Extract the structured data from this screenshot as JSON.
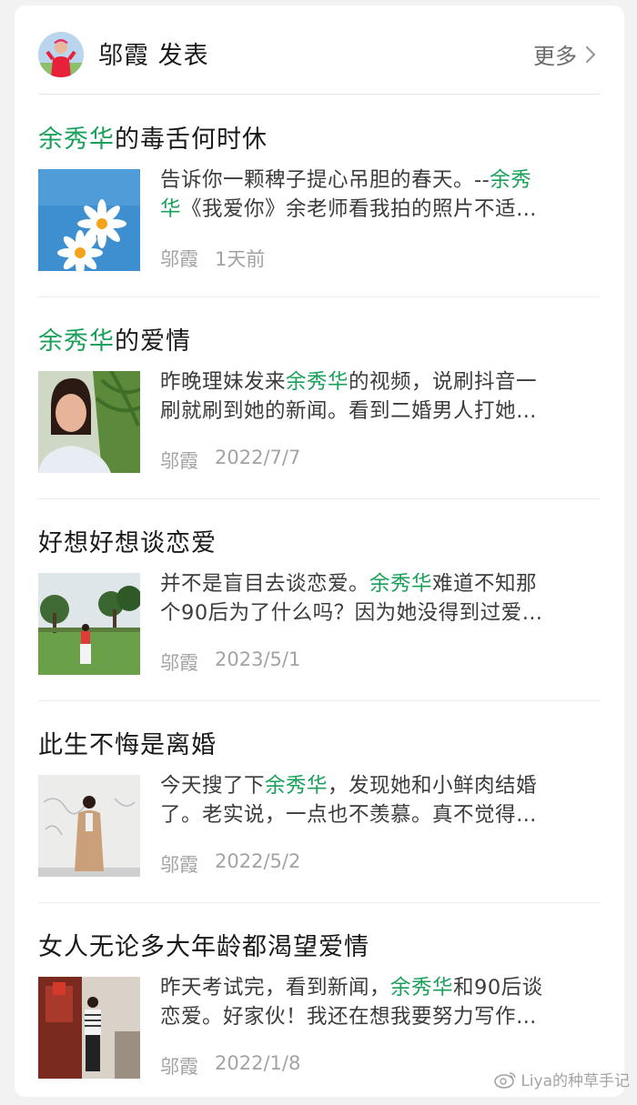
{
  "header": {
    "author": "邬霞",
    "action": "发表",
    "more_label": "更多"
  },
  "articles": [
    {
      "title_highlight": "余秀华",
      "title_rest": "的毒舌何时休",
      "excerpt_line1_a": "告诉你一颗稗子提心吊胆的春天。--",
      "excerpt_line1_hl": "余秀",
      "excerpt_line2_hl": "华",
      "excerpt_line2_b": "《我爱你》余老师看我拍的照片不适…",
      "author": "邬霞",
      "time": "1天前"
    },
    {
      "title_highlight": "余秀华",
      "title_rest": "的爱情",
      "excerpt_line1_a": "昨晚理妹发来",
      "excerpt_line1_hl": "余秀华",
      "excerpt_line1_b": "的视频，说刷抖音一",
      "excerpt_line2": "刷就刷到她的新闻。看到二婚男人打她…",
      "author": "邬霞",
      "time": "2022/7/7"
    },
    {
      "title": "好想好想谈恋爱",
      "excerpt_line1_a": "并不是盲目去谈恋爱。",
      "excerpt_line1_hl": "余秀华",
      "excerpt_line1_b": "难道不知那",
      "excerpt_line2": "个90后为了什么吗？因为她没得到过爱…",
      "author": "邬霞",
      "time": "2023/5/1"
    },
    {
      "title": "此生不悔是离婚",
      "excerpt_line1_a": "今天搜了下",
      "excerpt_line1_hl": "余秀华",
      "excerpt_line1_b": "，发现她和小鲜肉结婚",
      "excerpt_line2": "了。老实说，一点也不羡慕。真不觉得…",
      "author": "邬霞",
      "time": "2022/5/2"
    },
    {
      "title": "女人无论多大年龄都渴望爱情",
      "excerpt_line1_a": "昨天考试完，看到新闻，",
      "excerpt_line1_hl": "余秀华",
      "excerpt_line1_b": "和90后谈",
      "excerpt_line2": "恋爱。好家伙！我还在想我要努力写作…",
      "author": "邬霞",
      "time": "2022/1/8"
    }
  ],
  "watermark": "Liya的种草手记",
  "colors": {
    "highlight": "#1aa05a",
    "meta": "#a3a3a3",
    "background": "#f2f2f2"
  }
}
